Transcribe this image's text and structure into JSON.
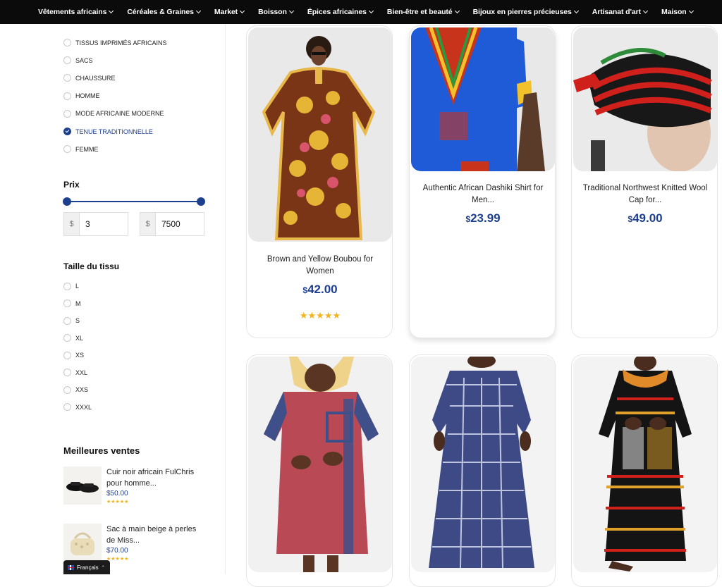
{
  "nav": {
    "items": [
      {
        "label": "Vêtements africains"
      },
      {
        "label": "Céréales & Graines"
      },
      {
        "label": "Market"
      },
      {
        "label": "Boisson"
      },
      {
        "label": "Épices africaines"
      },
      {
        "label": "Bien-être et beauté"
      },
      {
        "label": "Bijoux en pierres précieuses"
      },
      {
        "label": "Artisanat d'art"
      },
      {
        "label": "Maison"
      }
    ]
  },
  "sidebar": {
    "categories": [
      {
        "label": "TISSUS IMPRIMÉS AFRICAINS",
        "checked": false
      },
      {
        "label": "SACS",
        "checked": false
      },
      {
        "label": "CHAUSSURE",
        "checked": false
      },
      {
        "label": "HOMME",
        "checked": false
      },
      {
        "label": "MODE AFRICAINE MODERNE",
        "checked": false
      },
      {
        "label": "TENUE TRADITIONNELLE",
        "checked": true
      },
      {
        "label": "FEMME",
        "checked": false
      }
    ],
    "price": {
      "title": "Prix",
      "currency": "$",
      "min": "3",
      "max": "7500"
    },
    "sizes": {
      "title": "Taille du tissu",
      "items": [
        "L",
        "M",
        "S",
        "XL",
        "XS",
        "XXL",
        "XXS",
        "XXXL"
      ]
    },
    "best_sellers": {
      "title": "Meilleures ventes",
      "items": [
        {
          "name": "Cuir noir africain FulChris pour homme...",
          "price": "$50.00",
          "rating": 5
        },
        {
          "name": "Sac à main beige à perles de Miss...",
          "price": "$70.00",
          "rating": 5
        }
      ]
    },
    "language": "Français"
  },
  "products": [
    {
      "title": "Brown and Yellow Boubou for Women",
      "currency": "$",
      "price": "42.00",
      "rating": 5,
      "stars": "★★★★★"
    },
    {
      "title": "Authentic African Dashiki Shirt for Men...",
      "currency": "$",
      "price": "23.99"
    },
    {
      "title": "Traditional Northwest Knitted Wool Cap for...",
      "currency": "$",
      "price": "49.00"
    },
    {
      "title": "",
      "currency": "",
      "price": ""
    },
    {
      "title": "",
      "currency": "",
      "price": ""
    },
    {
      "title": "",
      "currency": "",
      "price": ""
    }
  ],
  "colors": {
    "accent": "#1d3f8f",
    "star": "#f3b41b",
    "nav_bg": "#0b0b0b"
  }
}
